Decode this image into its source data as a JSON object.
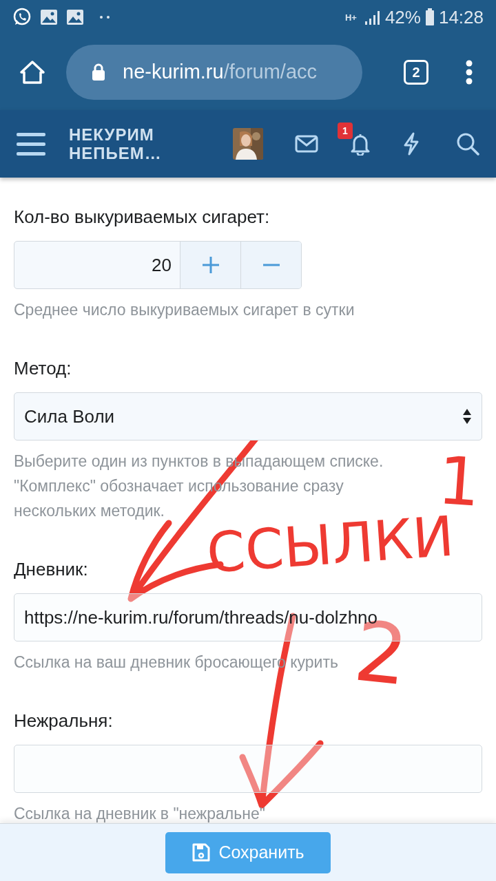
{
  "status_bar": {
    "battery": "42%",
    "time": "14:28",
    "network": "H+"
  },
  "browser": {
    "url_host": "ne-kurim.ru",
    "url_path": "/forum/acc",
    "tab_count": "2"
  },
  "site_header": {
    "logo_lines": [
      "НЕКУРИМ",
      "НЕПЬЕМ…"
    ],
    "notification_count": "1"
  },
  "form": [
    {
      "kind": "number",
      "label": "Кол-во выкуриваемых сигарет:",
      "value": "20",
      "hint": "Среднее число выкуриваемых сигарет в сутки"
    },
    {
      "kind": "select",
      "label": "Метод:",
      "value": "Сила Воли",
      "hint": "Выберите один из пунктов в выпадающем списке. \"Комплекс\" обозначает использование сразу нескольких методик."
    },
    {
      "kind": "text",
      "label": "Дневник:",
      "value": "https://ne-kurim.ru/forum/threads/nu-dolzhno",
      "hint": "Ссылка на ваш дневник бросающего курить"
    },
    {
      "kind": "text",
      "label": "Нежральня:",
      "hint": "Ссылка на дневник в \"нежральне\""
    }
  ],
  "save_button": "Сохранить",
  "annotations": [
    {
      "kind": "digit",
      "text": "1"
    },
    {
      "kind": "word",
      "text": "ССЫЛКИ"
    },
    {
      "kind": "digit",
      "text": "2"
    }
  ]
}
